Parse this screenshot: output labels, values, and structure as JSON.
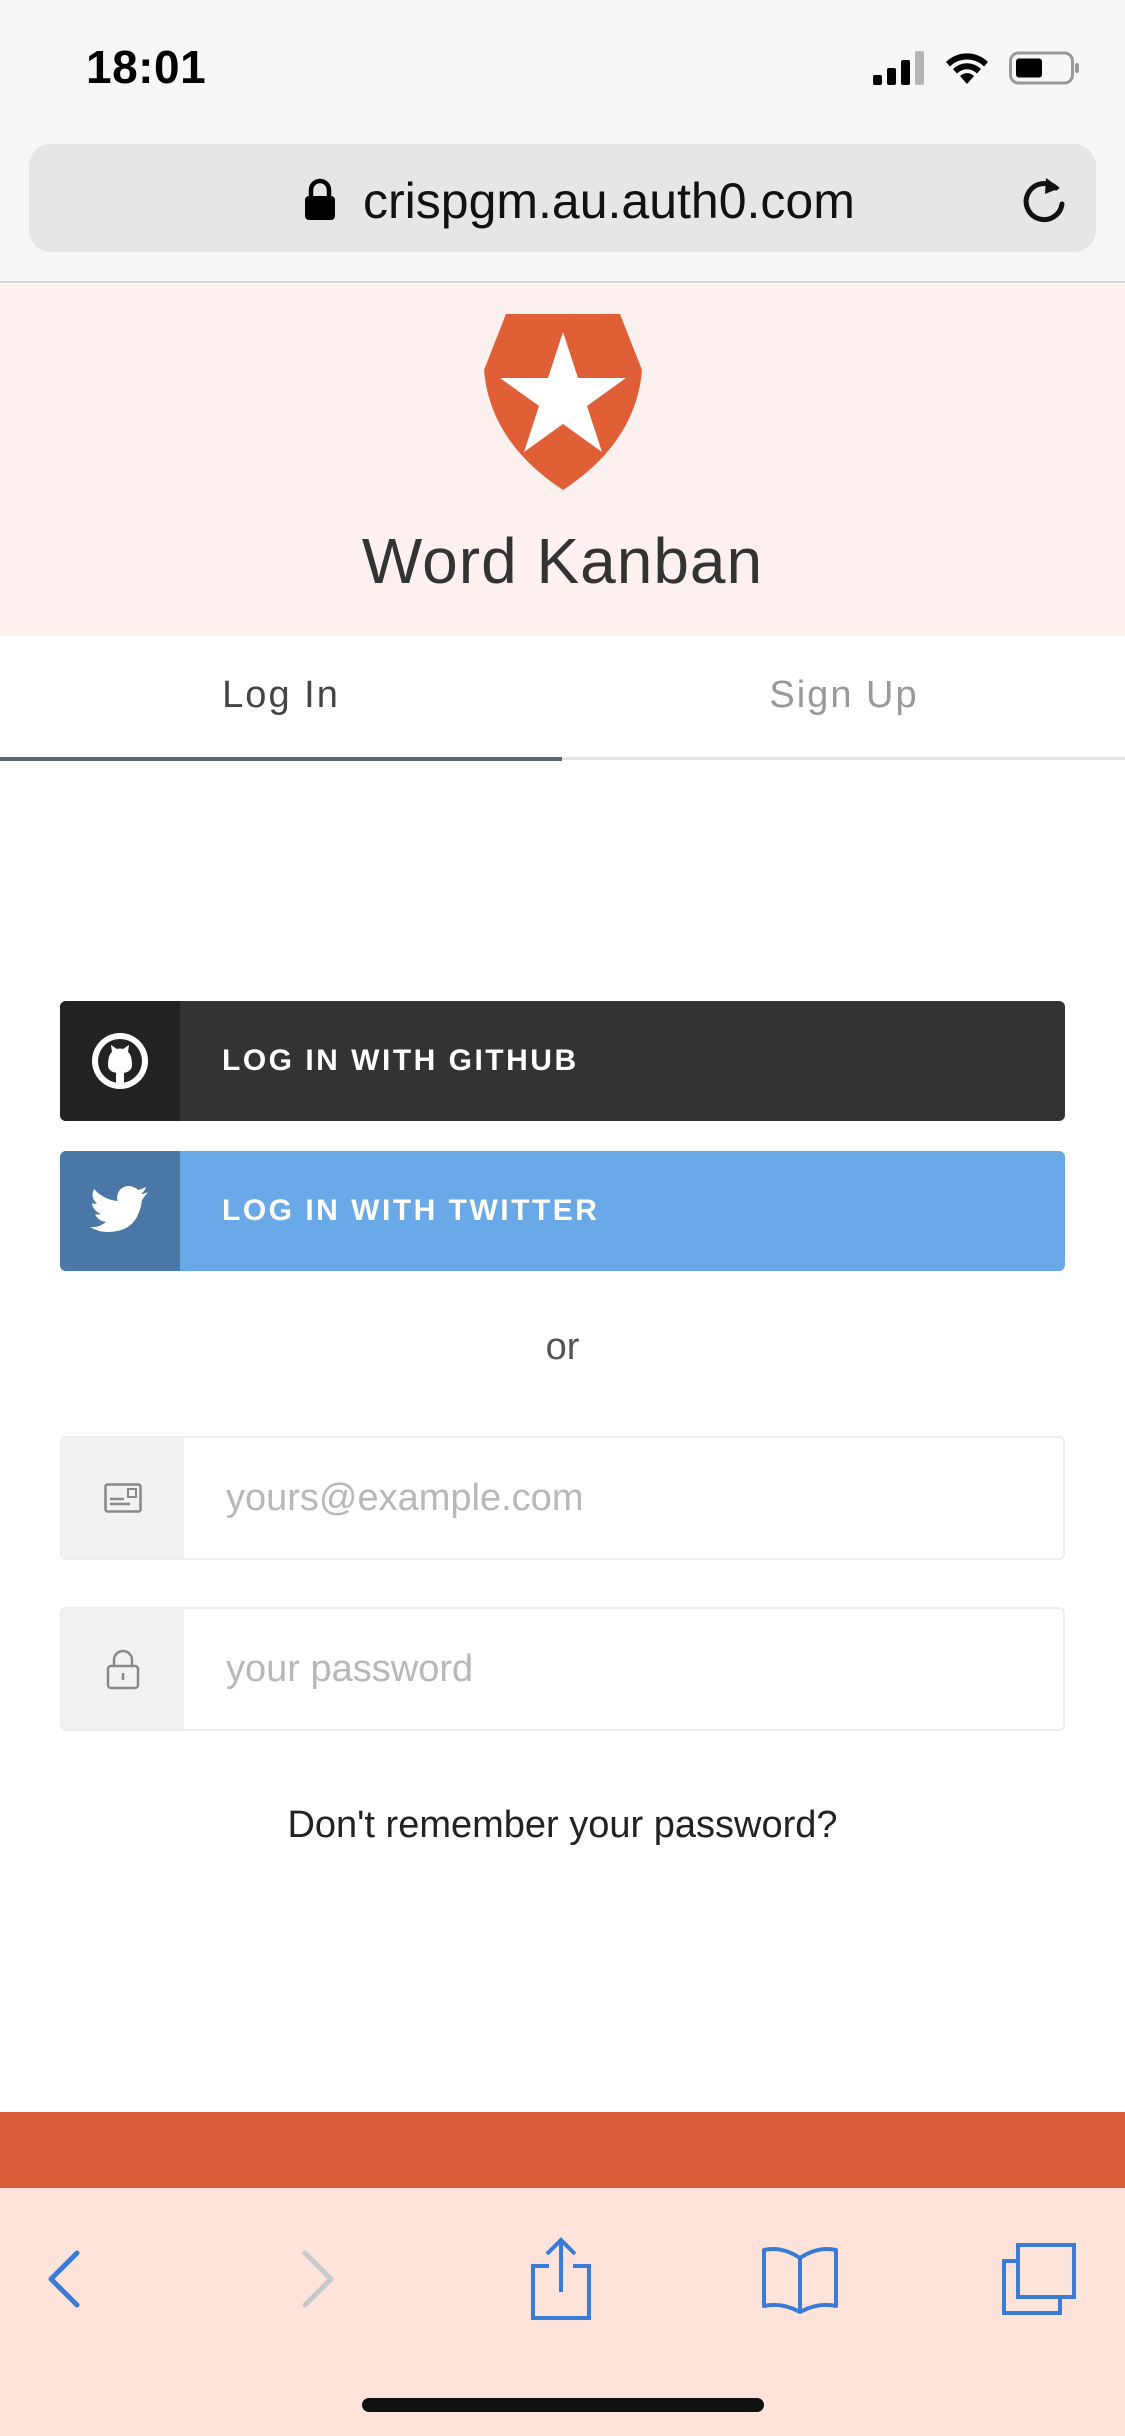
{
  "status_bar": {
    "time": "18:01"
  },
  "browser": {
    "url": "crispgm.au.auth0.com"
  },
  "header": {
    "app_title": "Word Kanban"
  },
  "tabs": {
    "login": "Log In",
    "signup": "Sign Up"
  },
  "social": {
    "github_label": "LOG IN WITH GITHUB",
    "twitter_label": "LOG IN WITH TWITTER"
  },
  "separator": "or",
  "form": {
    "email_placeholder": "yours@example.com",
    "password_placeholder": "your password",
    "forgot_password": "Don't remember your password?"
  },
  "colors": {
    "brand": "#d95d38",
    "github": "#333333",
    "twitter": "#6aa9e8",
    "ios_blue": "#3a7bd5"
  },
  "toolbar_icons": [
    "back-icon",
    "forward-icon",
    "share-icon",
    "bookmarks-icon",
    "tabs-icon"
  ]
}
